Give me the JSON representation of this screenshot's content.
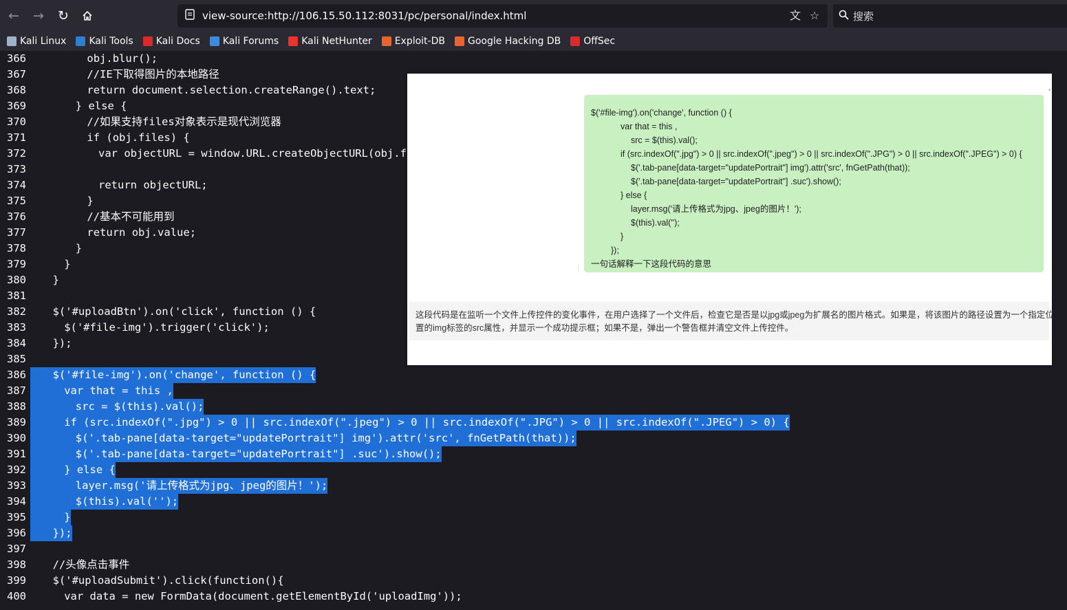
{
  "browser": {
    "url": "view-source:http://106.15.50.112:8031/pc/personal/index.html",
    "search_placeholder": "搜索",
    "icons": {
      "back": "arrow-left-icon",
      "forward": "arrow-right-icon",
      "reload": "reload-icon",
      "home": "home-icon",
      "page": "page-info-icon",
      "translate": "translate-icon",
      "bookmark": "star-icon",
      "search": "search-icon"
    }
  },
  "bookmarks": [
    {
      "label": "Kali Linux",
      "icon": "kali-dragon-icon",
      "color": "#9fb3c8"
    },
    {
      "label": "Kali Tools",
      "icon": "kali-tools-icon",
      "color": "#2d7fd3"
    },
    {
      "label": "Kali Docs",
      "icon": "kali-docs-icon",
      "color": "#d92b2b"
    },
    {
      "label": "Kali Forums",
      "icon": "kali-forums-icon",
      "color": "#3b8be0"
    },
    {
      "label": "Kali NetHunter",
      "icon": "nethunter-icon",
      "color": "#e8332f"
    },
    {
      "label": "Exploit-DB",
      "icon": "exploit-db-icon",
      "color": "#e8652f"
    },
    {
      "label": "Google Hacking DB",
      "icon": "ghdb-icon",
      "color": "#e8652f"
    },
    {
      "label": "OffSec",
      "icon": "offsec-icon",
      "color": "#d92b2b"
    }
  ],
  "source_lines": [
    {
      "n": "366",
      "indent": 8,
      "text": "obj.blur();",
      "sel": false
    },
    {
      "n": "367",
      "indent": 8,
      "text": "//IE下取得图片的本地路径",
      "sel": false
    },
    {
      "n": "368",
      "indent": 8,
      "text": "return document.selection.createRange().text;",
      "sel": false
    },
    {
      "n": "369",
      "indent": 6,
      "text": "} else {",
      "sel": false
    },
    {
      "n": "370",
      "indent": 8,
      "text": "//如果支持files对象表示是现代浏览器",
      "sel": false
    },
    {
      "n": "371",
      "indent": 8,
      "text": "if (obj.files) {",
      "sel": false
    },
    {
      "n": "372",
      "indent": 10,
      "text": "var objectURL = window.URL.createObjectURL(obj.files[0]);",
      "sel": false
    },
    {
      "n": "373",
      "indent": 0,
      "text": "",
      "sel": false
    },
    {
      "n": "374",
      "indent": 10,
      "text": "return objectURL;",
      "sel": false
    },
    {
      "n": "375",
      "indent": 8,
      "text": "}",
      "sel": false
    },
    {
      "n": "376",
      "indent": 8,
      "text": "//基本不可能用到",
      "sel": false
    },
    {
      "n": "377",
      "indent": 8,
      "text": "return obj.value;",
      "sel": false
    },
    {
      "n": "378",
      "indent": 6,
      "text": "}",
      "sel": false
    },
    {
      "n": "379",
      "indent": 4,
      "text": "}",
      "sel": false
    },
    {
      "n": "380",
      "indent": 2,
      "text": "}",
      "sel": false
    },
    {
      "n": "381",
      "indent": 0,
      "text": "",
      "sel": false
    },
    {
      "n": "382",
      "indent": 2,
      "text": "$('#uploadBtn').on('click', function () {",
      "sel": false
    },
    {
      "n": "383",
      "indent": 4,
      "text": "$('#file-img').trigger('click');",
      "sel": false
    },
    {
      "n": "384",
      "indent": 2,
      "text": "});",
      "sel": false
    },
    {
      "n": "385",
      "indent": 0,
      "text": "",
      "sel": false
    },
    {
      "n": "386",
      "indent": 2,
      "text": "$('#file-img').on('change', function () {",
      "sel": true
    },
    {
      "n": "387",
      "indent": 4,
      "text": "var that = this ,",
      "sel": true
    },
    {
      "n": "388",
      "indent": 6,
      "text": "src = $(this).val();",
      "sel": true
    },
    {
      "n": "389",
      "indent": 4,
      "text": "if (src.indexOf(\".jpg\") > 0 || src.indexOf(\".jpeg\") > 0 || src.indexOf(\".JPG\") > 0 || src.indexOf(\".JPEG\") > 0) {",
      "sel": true
    },
    {
      "n": "390",
      "indent": 6,
      "text": "$('.tab-pane[data-target=\"updatePortrait\"] img').attr('src', fnGetPath(that));",
      "sel": true
    },
    {
      "n": "391",
      "indent": 6,
      "text": "$('.tab-pane[data-target=\"updatePortrait\"] .suc').show();",
      "sel": true
    },
    {
      "n": "392",
      "indent": 4,
      "text": "} else {",
      "sel": true
    },
    {
      "n": "393",
      "indent": 6,
      "text": "layer.msg('请上传格式为jpg、jpeg的图片！');",
      "sel": true
    },
    {
      "n": "394",
      "indent": 6,
      "text": "$(this).val('');",
      "sel": true
    },
    {
      "n": "395",
      "indent": 4,
      "text": "}",
      "sel": true
    },
    {
      "n": "396",
      "indent": 2,
      "text": "});",
      "sel": true
    },
    {
      "n": "397",
      "indent": 0,
      "text": "",
      "sel": false
    },
    {
      "n": "398",
      "indent": 2,
      "text": "//头像点击事件",
      "sel": false
    },
    {
      "n": "399",
      "indent": 2,
      "text": "$('#uploadSubmit').click(function(){",
      "sel": false
    },
    {
      "n": "400",
      "indent": 4,
      "text": "var data = new FormData(document.getElementById('uploadImg'));",
      "sel": false
    }
  ],
  "chat": {
    "question_code": [
      "$('#file-img').on('change', function () {",
      "var that = this ,",
      "src = $(this).val();",
      "if (src.indexOf(\".jpg\") > 0 || src.indexOf(\".jpeg\") > 0 || src.indexOf(\".JPG\") > 0 || src.indexOf(\".JPEG\") > 0) {",
      "$('.tab-pane[data-target=\"updatePortrait\"] img').attr('src', fnGetPath(that));",
      "$('.tab-pane[data-target=\"updatePortrait\"] .suc').show();",
      "} else {",
      "layer.msg('请上传格式为jpg、jpeg的图片！');",
      "$(this).val('');",
      "}",
      "});"
    ],
    "question_text": "一句话解释一下这段代码的意思",
    "answer_line1": "这段代码是在监听一个文件上传控件的变化事件，在用户选择了一个文件后，检查它是否是以jpg或jpeg为扩展名的图片格式。如果是，将该图片的路径设置为一个指定位",
    "answer_line2": "置的img标签的src属性，并显示一个成功提示框；如果不是，弹出一个警告框并清空文件上传控件。",
    "colors": {
      "bubble": "#c8f0c1",
      "answer_bg": "#f4f4f5"
    }
  },
  "colors": {
    "selection": "#1f6fd6",
    "page_bg": "#1c1b22",
    "toolbar_bg": "#2b2a33"
  }
}
